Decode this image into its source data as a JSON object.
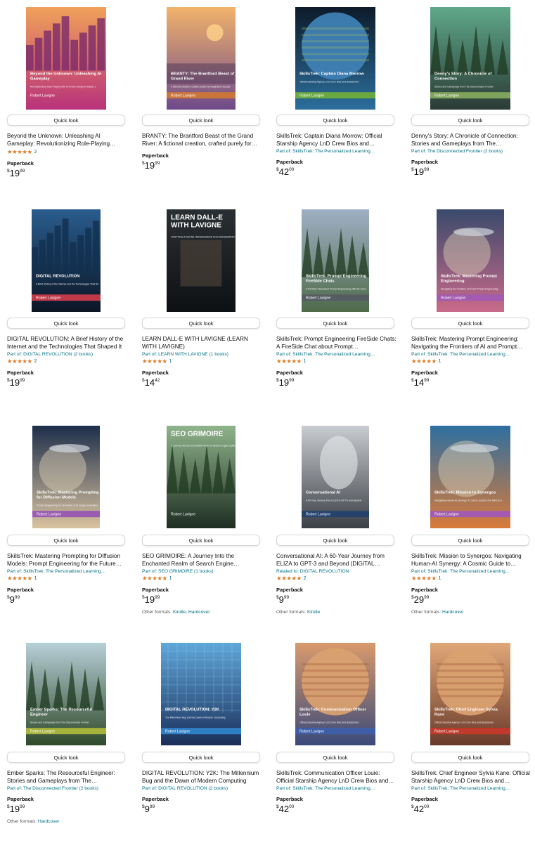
{
  "quick_look_label": "Quick look",
  "other_formats_label": "Other formats:",
  "stars_glyph": "★★★★★",
  "rating_color": "#de7921",
  "link_color": "#007185",
  "products": [
    {
      "title": "Beyond the Unknown: Unleashing AI Gameplay: Revolutionizing Role-Playing…",
      "series": "",
      "rating_count": "2",
      "format": "Paperback",
      "price": {
        "currency": "$",
        "whole": "19",
        "fraction": "99"
      },
      "other_formats": [],
      "cover": {
        "title": "Beyond the Unknown: Unleashing AI Gameplay",
        "subtitle": "Revolutionizing Role-Playing with AI-Driven Dungeon Master Logic",
        "author": "Robert Lavigne",
        "theme": "neon-city",
        "bg1": "#f0a15a",
        "bg2": "#b8327a",
        "band": "",
        "title_color": "#ffffff"
      }
    },
    {
      "title": "BRANTY: The Brantford Beast of the Grand River: A fictional creation, crafted purely for…",
      "series": "",
      "rating_count": "",
      "format": "Paperback",
      "price": {
        "currency": "$",
        "whole": "19",
        "fraction": "99"
      },
      "other_formats": [],
      "cover": {
        "title": "BRANTY: The Brantford Beast of the Grand River",
        "subtitle": "A fictional creation, crafted purely by imaginative storytelling and inspired by a GPT-3.0 hallucination.",
        "author": "Robert Lavigne",
        "theme": "sunset-lake",
        "bg1": "#f2b36b",
        "bg2": "#6e4a8a",
        "band": "#c9763a",
        "title_color": "#ffffff"
      }
    },
    {
      "title": "SkillsTrek: Captain Diana Morrow: Official Starship Agency LnD Crew Bios and…",
      "series": "Part of: SkillsTrek: The Personalized Learning…",
      "rating_count": "",
      "format": "Paperback",
      "price": {
        "currency": "$",
        "whole": "42",
        "fraction": "00"
      },
      "other_formats": [],
      "cover": {
        "title": "SkillsTrek: Captain Diana Morrow",
        "subtitle": "Official Starship Agency LnD Crew Bios and Backstories",
        "author": "Robert Lavigne",
        "theme": "planet",
        "bg1": "#0d1b2a",
        "bg2": "#2c6e9c",
        "band": "#6aa842",
        "title_color": "#ffffff"
      }
    },
    {
      "title": "Denny's Story: A Chronicle of Connection: Stories and Gameplays from The…",
      "series": "Part of: The Disconnected Frontier (2 books)",
      "rating_count": "",
      "format": "Paperback",
      "price": {
        "currency": "$",
        "whole": "19",
        "fraction": "99"
      },
      "other_formats": [],
      "cover": {
        "title": "Denny's Story: A Chronicle of Connection",
        "subtitle": "Stories and Gameplays from The Disconnected Frontier",
        "author": "Robert Lavigne",
        "theme": "ruins",
        "bg1": "#5fa88a",
        "bg2": "#2b3b36",
        "band": "#7fa35a",
        "title_color": "#ffffff"
      }
    },
    {
      "title": "DIGITAL REVOLUTION: A Brief History of the Internet and the Technologies That Shaped It",
      "series": "Part of: DIGITAL REVOLUTION (2 books)",
      "rating_count": "2",
      "format": "Paperback",
      "price": {
        "currency": "$",
        "whole": "19",
        "fraction": "99"
      },
      "other_formats": [],
      "cover": {
        "title": "DIGITAL REVOLUTION",
        "subtitle": "A Brief History of the Internet and the Technologies That Shaped It",
        "author": "Robert Lavigne",
        "theme": "cyber-city",
        "bg1": "#2a5d8f",
        "bg2": "#0b1524",
        "band": "#c0394a",
        "title_color": "#ffffff"
      }
    },
    {
      "title": "LEARN DALL-E WITH LAVIGNE (LEARN WITH LAVIGNE)",
      "series": "Part of: LEARN WITH LAVIGNE (1 books)",
      "rating_count": "1",
      "format": "Paperback",
      "price": {
        "currency": "$",
        "whole": "14",
        "fraction": "42"
      },
      "other_formats": [],
      "cover": {
        "title": "LEARN DALL-E WITH LAVIGNE",
        "subtitle": "CRAFTING A DIGITAL RENAISSANCE IN AI IMAGINATION",
        "author": "",
        "theme": "dark-art",
        "bg1": "#2a2f33",
        "bg2": "#0e1113",
        "band": "",
        "title_color": "#ffffff"
      }
    },
    {
      "title": "SkillsTrek: Prompt Engineering FireSide Chats: A FireSide Chat about Prompt…",
      "series": "Part of: SkillsTrek: The Personalized Learning…",
      "rating_count": "1",
      "format": "Paperback",
      "price": {
        "currency": "$",
        "whole": "19",
        "fraction": "99"
      },
      "other_formats": [],
      "cover": {
        "title": "SkillsTrek: Prompt Engineering FireSide Chats",
        "subtitle": "A FireSide Chat about Prompt Engineering with the Crew",
        "author": "Robert Lavigne",
        "theme": "valley",
        "bg1": "#9fb0c4",
        "bg2": "#4e6b4a",
        "band": "#555d63",
        "title_color": "#ffffff"
      }
    },
    {
      "title": "SkillsTrek: Mastering Prompt Engineering: Navigating the Frontiers of AI and Prompt…",
      "series": "Part of: SkillsTrek: The Personalized Learning…",
      "rating_count": "1",
      "format": "Paperback",
      "price": {
        "currency": "$",
        "whole": "14",
        "fraction": "99"
      },
      "other_formats": [],
      "cover": {
        "title": "SkillsTrek: Mastering Prompt Engineering",
        "subtitle": "Navigating the Frontiers of AI and Prompt Engineering",
        "author": "Robert Lavigne",
        "theme": "starship",
        "bg1": "#3a4a6b",
        "bg2": "#c96a8a",
        "band": "#a25bb0",
        "title_color": "#ffffff"
      }
    },
    {
      "title": "SkillsTrek: Mastering Prompting for Diffusion Models: Prompt Engineering for the Future…",
      "series": "Part of: SkillsTrek: The Personalized Learning…",
      "rating_count": "1",
      "format": "Paperback",
      "price": {
        "currency": "$",
        "whole": "9",
        "fraction": "99"
      },
      "other_formats": [],
      "cover": {
        "title": "SkillsTrek: Mastering Prompting for Diffusion Models",
        "subtitle": "Prompt Engineering for the Future of AI Image Generation",
        "author": "Robert Lavigne",
        "theme": "station",
        "bg1": "#1d2e4a",
        "bg2": "#d9c3a0",
        "band": "#9a5cb0",
        "title_color": "#ffffff"
      }
    },
    {
      "title": "SEO GRIMOIRE: A Journey Into the Enchanted Realm of Search Engine…",
      "series": "Part of: SEO GRIMOIRE (1 books)",
      "rating_count": "1",
      "format": "Paperback",
      "price": {
        "currency": "$",
        "whole": "19",
        "fraction": "99"
      },
      "other_formats": [
        "Kindle",
        "Hardcover"
      ],
      "cover": {
        "title": "SEO GRIMOIRE",
        "subtitle": "A Journey into the Enchanted Realm of Search Engine Optimization",
        "author": "Robert Lavigne",
        "theme": "forest",
        "bg1": "#8fb38a",
        "bg2": "#1e2e22",
        "band": "",
        "title_color": "#ffffff"
      }
    },
    {
      "title": "Conversational AI: A 60-Year Journey from ELIZA to GPT-3 and Beyond (DIGITAL…",
      "series": "Related to: DIGITAL REVOLUTION",
      "rating_count": "2",
      "format": "Paperback",
      "price": {
        "currency": "$",
        "whole": "9",
        "fraction": "99"
      },
      "other_formats": [
        "Kindle"
      ],
      "cover": {
        "title": "Conversational AI",
        "subtitle": "A 60-Year Journey from ELIZA to GPT-3 and Beyond",
        "author": "Robert Lavigne",
        "theme": "robot-face",
        "bg1": "#c9ccd0",
        "bg2": "#3b4046",
        "band": "#25426e",
        "title_color": "#ffffff"
      }
    },
    {
      "title": "SkillsTrek: Mission to Synergos: Navigating Human-AI Synergy: A Cosmic Guide to…",
      "series": "Part of: SkillsTrek: The Personalized Learning…",
      "rating_count": "1",
      "format": "Paperback",
      "price": {
        "currency": "$",
        "whole": "29",
        "fraction": "99"
      },
      "other_formats": [
        "Hardcover"
      ],
      "cover": {
        "title": "SkillsTrek: Mission to Synergos",
        "subtitle": "Navigating Human-AI Synergy: A Cosmic Guide to the Mind & Integration",
        "author": "Robert Lavigne",
        "theme": "alien-world",
        "bg1": "#2e6fa0",
        "bg2": "#d87b3a",
        "band": "#a25bb0",
        "title_color": "#ffffff"
      }
    },
    {
      "title": "Ember Sparks: The Resourceful Engineer: Stories and Gameplays from The…",
      "series": "Part of: The Disconnected Frontier (2 books)",
      "rating_count": "",
      "format": "Paperback",
      "price": {
        "currency": "$",
        "whole": "19",
        "fraction": "99"
      },
      "other_formats": [
        "Hardcover"
      ],
      "cover": {
        "title": "Ember Sparks: The Resourceful Engineer",
        "subtitle": "Stories and Gameplays from The Disconnected Frontier",
        "author": "Robert Lavigne",
        "theme": "pines",
        "bg1": "#b7cfd8",
        "bg2": "#2f4a2a",
        "band": "#a7b23a",
        "title_color": "#ffffff"
      }
    },
    {
      "title": "DIGITAL REVOLUTION: Y2K: The Millennium Bug and the Dawn of Modern Computing",
      "series": "Part of: DIGITAL REVOLUTION (2 books)",
      "rating_count": "",
      "format": "Paperback",
      "price": {
        "currency": "$",
        "whole": "9",
        "fraction": "99"
      },
      "other_formats": [],
      "cover": {
        "title": "DIGITAL REVOLUTION: Y2K",
        "subtitle": "The Millennium Bug and the Dawn of Modern Computing",
        "author": "Robert Lavigne",
        "theme": "circuit",
        "bg1": "#5fa7d9",
        "bg2": "#1a2f5a",
        "band": "#2f7fc4",
        "title_color": "#ffffff"
      }
    },
    {
      "title": "SkillsTrek: Communication Officer Louie: Official Starship Agency LnD Crew Bios and…",
      "series": "Part of: SkillsTrek: The Personalized Learning…",
      "rating_count": "",
      "format": "Paperback",
      "price": {
        "currency": "$",
        "whole": "42",
        "fraction": "00"
      },
      "other_formats": [],
      "cover": {
        "title": "SkillsTrek: Communication Officer Louie",
        "subtitle": "Official Starship Agency LnD Crew Bios and Backstories",
        "author": "Robert Lavigne",
        "theme": "gas-giant",
        "bg1": "#d99a6c",
        "bg2": "#3a4a7a",
        "band": "#3e5fa8",
        "title_color": "#ffffff"
      }
    },
    {
      "title": "SkillsTrek: Chief Engineer Sylvia Kane: Official Starship Agency LnD Crew Bios and…",
      "series": "Part of: SkillsTrek: The Personalized Learning…",
      "rating_count": "",
      "format": "Paperback",
      "price": {
        "currency": "$",
        "whole": "42",
        "fraction": "00"
      },
      "other_formats": [],
      "cover": {
        "title": "SkillsTrek: Chief Engineer Sylvia Kane",
        "subtitle": "Official Starship Agency LnD Crew Bios and Backstories",
        "author": "Robert Lavigne",
        "theme": "jupiter",
        "bg1": "#e0a878",
        "bg2": "#6a3a2a",
        "band": "#c0392b",
        "title_color": "#ffffff"
      }
    }
  ]
}
